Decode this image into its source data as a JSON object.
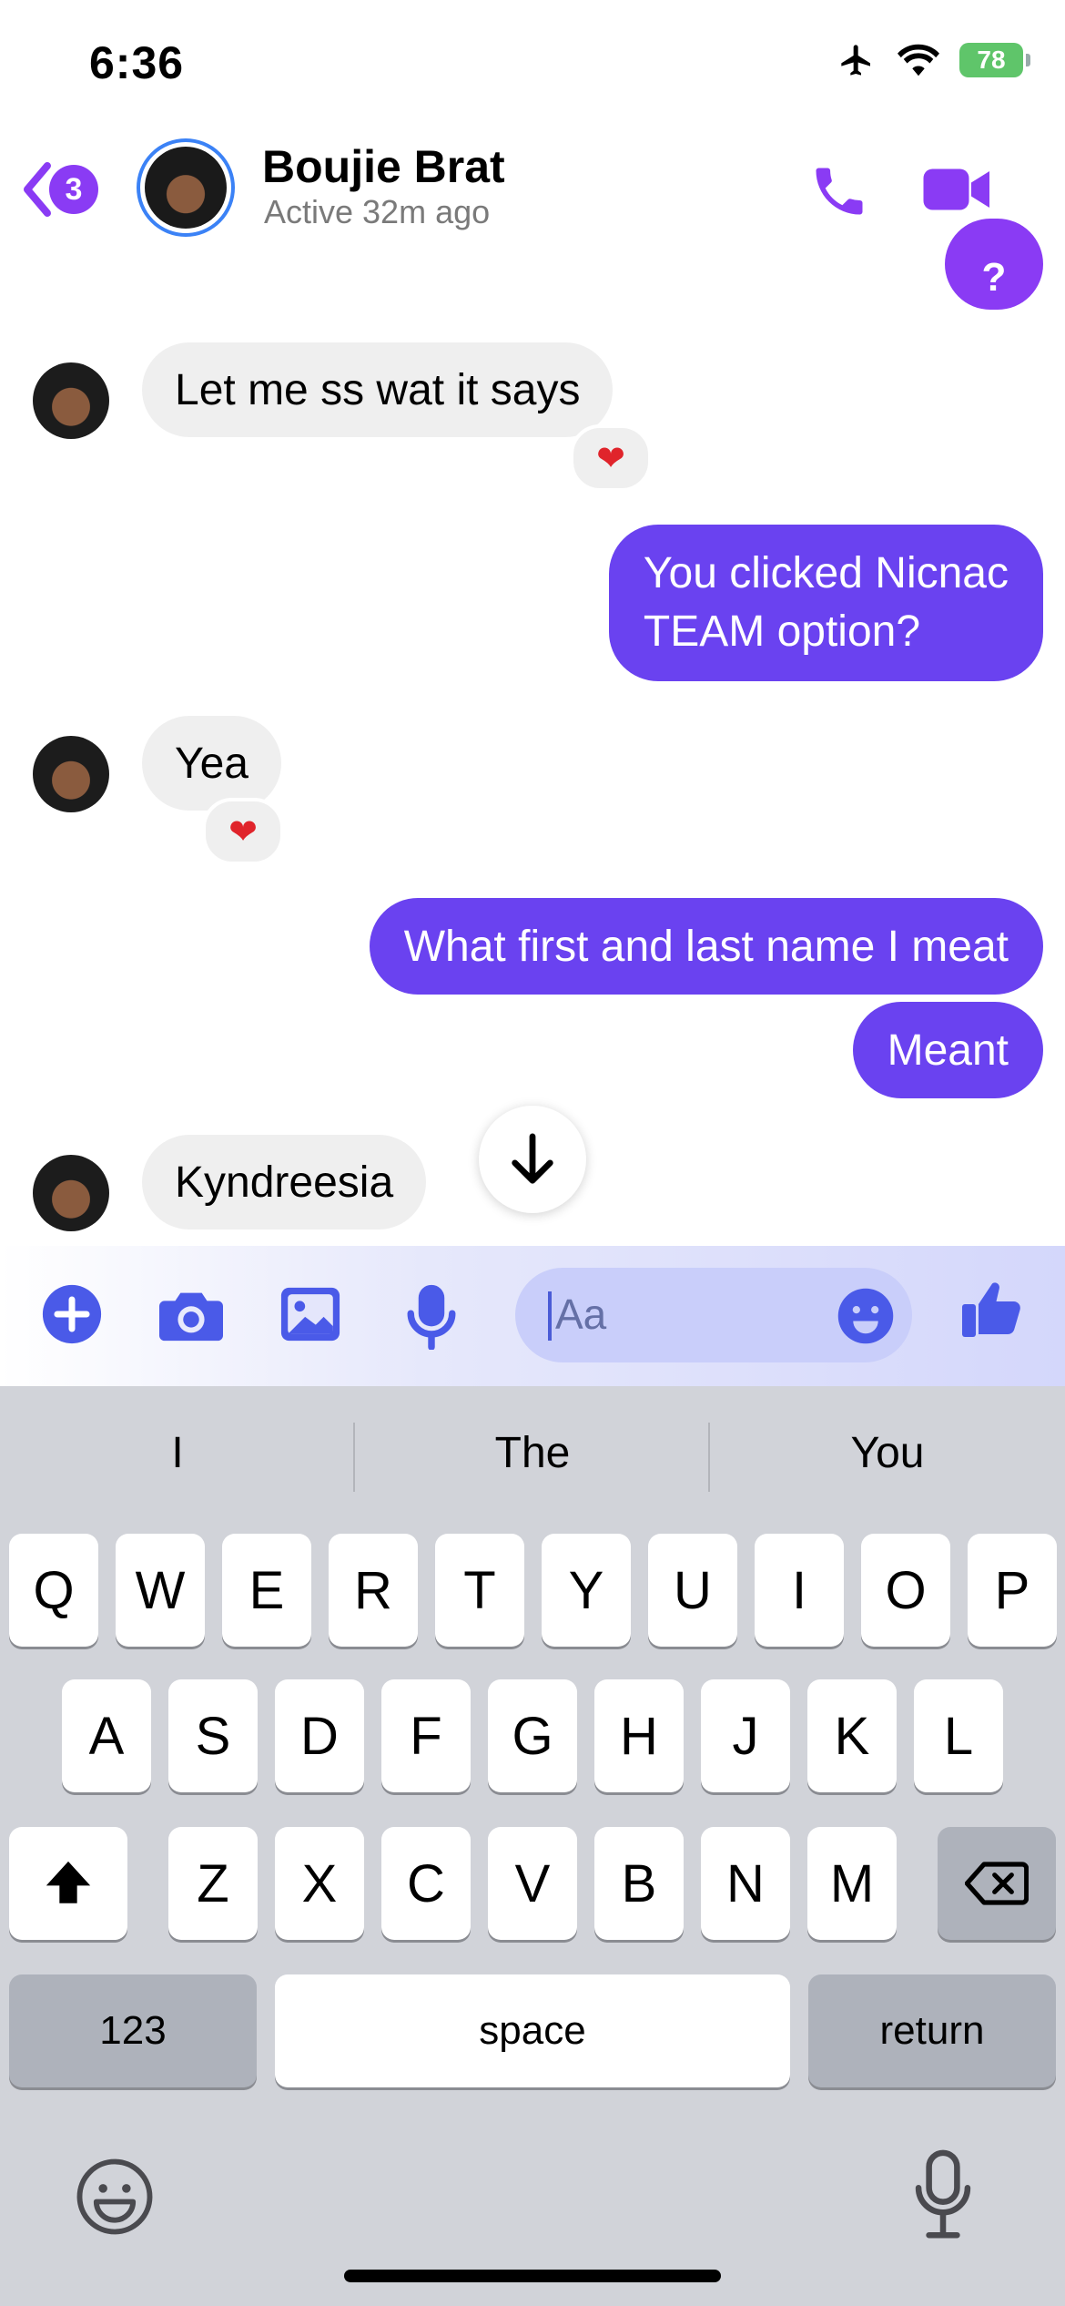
{
  "status_bar": {
    "time": "6:36",
    "battery": "78",
    "icons": [
      "airplane-icon",
      "wifi-icon",
      "battery-icon"
    ]
  },
  "header": {
    "back_count": "3",
    "contact_name": "Boujie Brat",
    "active_status": "Active 32m ago",
    "icons": [
      "back-chevron-icon",
      "phone-icon",
      "video-icon"
    ],
    "accent": "#8a3bf4"
  },
  "messages": [
    {
      "side": "out",
      "text": "?"
    },
    {
      "side": "in",
      "text": "Let me ss wat it says",
      "reaction": "❤"
    },
    {
      "side": "out",
      "text_lines": [
        "You clicked Nicnac",
        "TEAM option?"
      ]
    },
    {
      "side": "in",
      "text": "Yea",
      "reaction": "❤"
    },
    {
      "side": "out",
      "text": "What first and last name I meat"
    },
    {
      "side": "out",
      "text": "Meant"
    },
    {
      "side": "in",
      "text": "Kyndreesia"
    }
  ],
  "composer": {
    "placeholder": "Aa",
    "icons": [
      "plus-icon",
      "camera-icon",
      "photo-icon",
      "microphone-icon",
      "emoji-icon",
      "thumbs-up-icon"
    ]
  },
  "keyboard": {
    "suggestions": [
      "I",
      "The",
      "You"
    ],
    "row1": [
      "Q",
      "W",
      "E",
      "R",
      "T",
      "Y",
      "U",
      "I",
      "O",
      "P"
    ],
    "row2": [
      "A",
      "S",
      "D",
      "F",
      "G",
      "H",
      "J",
      "K",
      "L"
    ],
    "row3": [
      "Z",
      "X",
      "C",
      "V",
      "B",
      "N",
      "M"
    ],
    "numbers_key": "123",
    "space_key": "space",
    "return_key": "return"
  },
  "colors": {
    "outgoing_bubble": "#6a42f0",
    "incoming_bubble": "#efefef",
    "keyboard_bg": "#d1d3d9"
  }
}
